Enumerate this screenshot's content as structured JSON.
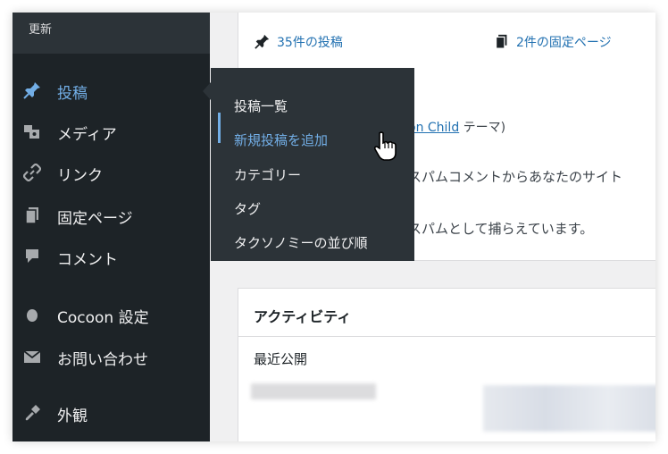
{
  "sidebar": {
    "update_label": "更新",
    "items": [
      {
        "label": "投稿",
        "icon": "pushpin-icon"
      },
      {
        "label": "メディア",
        "icon": "media-icon"
      },
      {
        "label": "リンク",
        "icon": "link-icon"
      },
      {
        "label": "固定ページ",
        "icon": "page-icon"
      },
      {
        "label": "コメント",
        "icon": "comment-icon"
      },
      {
        "label": "Cocoon 設定",
        "icon": "circle-icon"
      },
      {
        "label": "お問い合わせ",
        "icon": "mail-icon"
      },
      {
        "label": "外観",
        "icon": "brush-icon"
      }
    ]
  },
  "submenu": {
    "items": [
      "投稿一覧",
      "新規投稿を追加",
      "カテゴリー",
      "タグ",
      "タクソノミーの並び順"
    ]
  },
  "glance": {
    "posts": "35件の投稿",
    "pages": "2件の固定ページ"
  },
  "theme": {
    "link_fragment": "on Child",
    "suffix": "テーマ)"
  },
  "spam": {
    "line1": "スパムコメントからあなたのサイト",
    "line2": "スパムとして捕らえています。"
  },
  "activity": {
    "title": "アクティビティ",
    "subtitle": "最近公開"
  },
  "colors": {
    "sidebar_bg": "#1d2327",
    "submenu_bg": "#2c3338",
    "accent": "#72aee6",
    "link": "#2271b1"
  }
}
